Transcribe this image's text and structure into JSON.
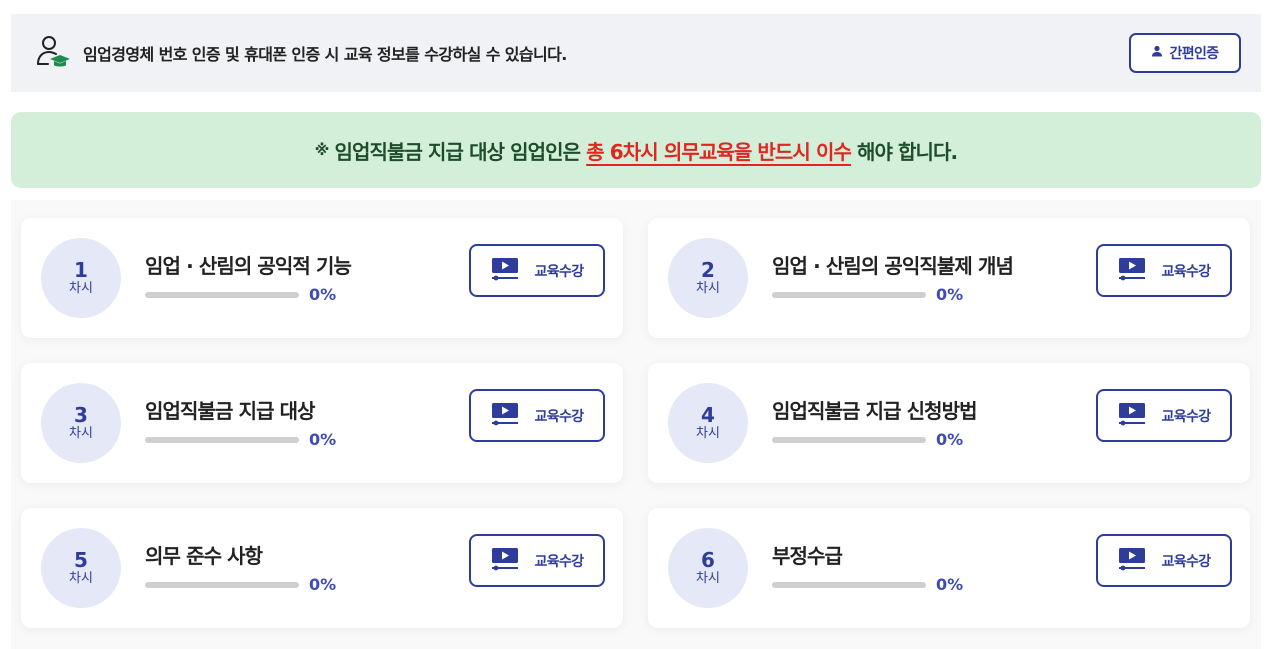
{
  "auth_bar": {
    "message": "임업경영체 번호 인증 및 휴대폰 인증 시 교육 정보를 수강하실 수 있습니다.",
    "button_label": "간편인증",
    "icon": "user-graduate-icon"
  },
  "notice": {
    "mark": "※",
    "prefix": "임업직불금 지급 대상 임업인은",
    "emphasis": "총 6차시 의무교육을 반드시 이수",
    "suffix": "해야 합니다.",
    "emphasis_color": "#e0261f",
    "background_color": "#d3efd9"
  },
  "colors": {
    "accent": "#2f3d9a",
    "progress": "#3f4db3"
  },
  "courses": [
    {
      "number": "1",
      "unit": "차시",
      "title": "임업 · 산림의 공익적 기능",
      "progress": 0,
      "progress_label": "0%",
      "button_label": "교육수강"
    },
    {
      "number": "2",
      "unit": "차시",
      "title": "임업 · 산림의 공익직불제 개념",
      "progress": 0,
      "progress_label": "0%",
      "button_label": "교육수강"
    },
    {
      "number": "3",
      "unit": "차시",
      "title": "임업직불금 지급 대상",
      "progress": 0,
      "progress_label": "0%",
      "button_label": "교육수강"
    },
    {
      "number": "4",
      "unit": "차시",
      "title": "임업직불금 지급 신청방법",
      "progress": 0,
      "progress_label": "0%",
      "button_label": "교육수강"
    },
    {
      "number": "5",
      "unit": "차시",
      "title": "의무 준수 사항",
      "progress": 0,
      "progress_label": "0%",
      "button_label": "교육수강"
    },
    {
      "number": "6",
      "unit": "차시",
      "title": "부정수급",
      "progress": 0,
      "progress_label": "0%",
      "button_label": "교육수강"
    }
  ]
}
